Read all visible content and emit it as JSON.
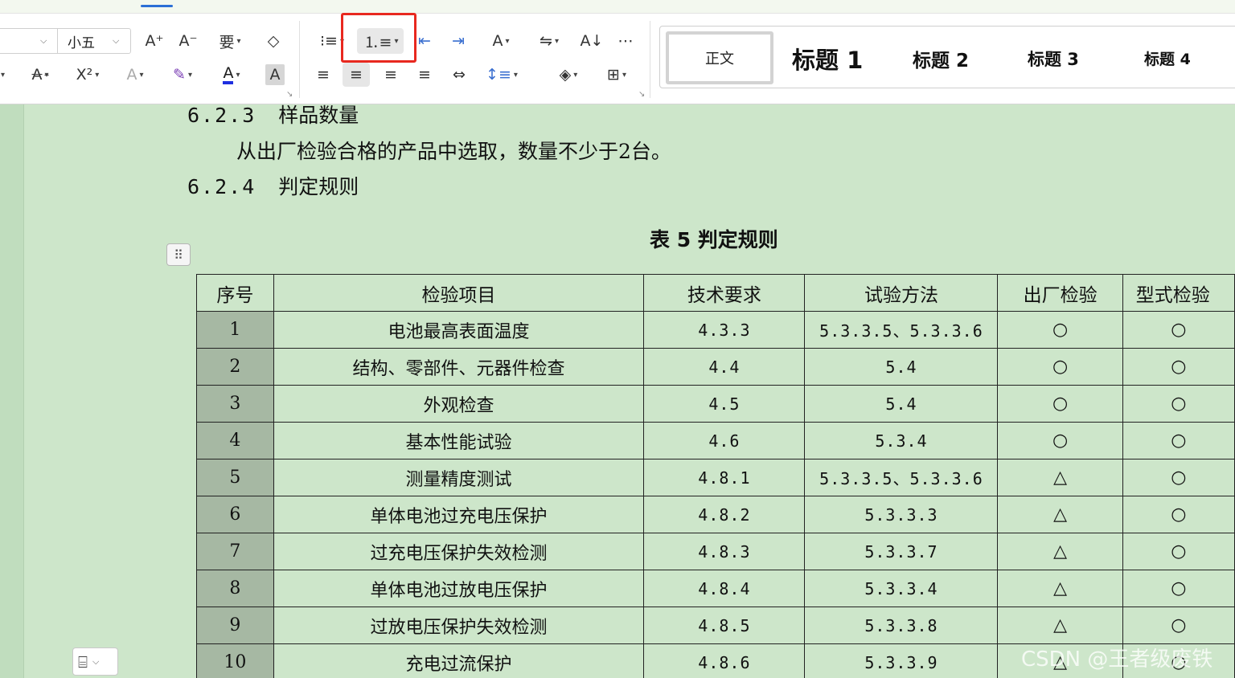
{
  "toolbar": {
    "font_size": "小五",
    "buttons": {
      "grow_font": "A⁺",
      "shrink_font": "A⁻",
      "phonetic_guide": "要",
      "clear_format": "◇",
      "strikethrough": "A",
      "superscript": "X²",
      "text_effect": "A",
      "highlight": "✎",
      "font_color": "A",
      "char_shading": "A",
      "bullets": "⁝≡",
      "numbering": "⒈≡",
      "decrease_indent": "⇤",
      "increase_indent": "⇥",
      "char_spacing": "A",
      "text_direction": "⇋",
      "sort": "A↓",
      "show_marks": "⋯",
      "align_left": "≡",
      "align_center": "≡",
      "align_right": "≡",
      "justify": "≡",
      "distribute": "⇔",
      "line_spacing": "↕≡",
      "shading": "◈",
      "borders": "⊞"
    }
  },
  "styles": {
    "normal": "正文",
    "h1": "标题 1",
    "h2": "标题 2",
    "h3": "标题 3",
    "h4": "标题 4"
  },
  "document": {
    "section_623_num": "6.2.3",
    "section_623_title": "样品数量",
    "sample_text": "从出厂检验合格的产品中选取，数量不少于2台。",
    "section_624_num": "6.2.4",
    "section_624_title": "判定规则",
    "table_caption": "表 5  判定规则",
    "table": {
      "headers": [
        "序号",
        "检验项目",
        "技术要求",
        "试验方法",
        "出厂检验",
        "型式检验"
      ],
      "rows": [
        {
          "no": "1",
          "item": "电池最高表面温度",
          "req": "4.3.3",
          "method": "5.3.3.5、5.3.3.6",
          "factory": "○",
          "type": "○"
        },
        {
          "no": "2",
          "item": "结构、零部件、元器件检查",
          "req": "4.4",
          "method": "5.4",
          "factory": "○",
          "type": "○"
        },
        {
          "no": "3",
          "item": "外观检查",
          "req": "4.5",
          "method": "5.4",
          "factory": "○",
          "type": "○"
        },
        {
          "no": "4",
          "item": "基本性能试验",
          "req": "4.6",
          "method": "5.3.4",
          "factory": "○",
          "type": "○"
        },
        {
          "no": "5",
          "item": "测量精度测试",
          "req": "4.8.1",
          "method": "5.3.3.5、5.3.3.6",
          "factory": "△",
          "type": "○"
        },
        {
          "no": "6",
          "item": "单体电池过充电压保护",
          "req": "4.8.2",
          "method": "5.3.3.3",
          "factory": "△",
          "type": "○"
        },
        {
          "no": "7",
          "item": "过充电压保护失效检测",
          "req": "4.8.3",
          "method": "5.3.3.7",
          "factory": "△",
          "type": "○"
        },
        {
          "no": "8",
          "item": "单体电池过放电压保护",
          "req": "4.8.4",
          "method": "5.3.3.4",
          "factory": "△",
          "type": "○"
        },
        {
          "no": "9",
          "item": "过放电压保护失效检测",
          "req": "4.8.5",
          "method": "5.3.3.8",
          "factory": "△",
          "type": "○"
        },
        {
          "no": "10",
          "item": "充电过流保护",
          "req": "4.8.6",
          "method": "5.3.3.9",
          "factory": "△",
          "type": "○"
        }
      ]
    }
  },
  "watermark": "CSDN @王者级废铁"
}
